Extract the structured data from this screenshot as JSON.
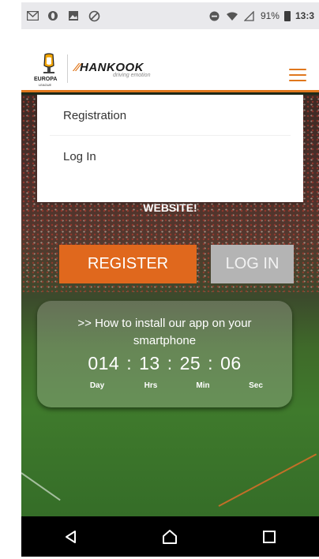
{
  "status_bar": {
    "battery": "91%",
    "time": "13:3",
    "icons": [
      "gmail-icon",
      "opera-icon",
      "gallery-icon",
      "vpn-icon",
      "dnd-icon",
      "wifi-icon",
      "signal-icon",
      "battery-icon"
    ]
  },
  "header": {
    "brand": "HANKOOK",
    "tagline": "driving emotion",
    "league_line1": "EUROPA",
    "league_line2": "LEAGUE"
  },
  "menu": {
    "items": [
      {
        "label": "Registration"
      },
      {
        "label": "Log In"
      }
    ]
  },
  "hero": {
    "heading_tail": "WEBSITE!",
    "register_label": "REGISTER",
    "login_label": "LOG IN",
    "install_link": ">> How to install our app on your smartphone"
  },
  "countdown": {
    "days": "014",
    "hours": "13",
    "minutes": "25",
    "seconds": "06",
    "day_label": "Day",
    "hrs_label": "Hrs",
    "min_label": "Min",
    "sec_label": "Sec"
  },
  "colors": {
    "accent": "#e0771d",
    "register": "#e0681d",
    "login": "#b4b4b4"
  }
}
